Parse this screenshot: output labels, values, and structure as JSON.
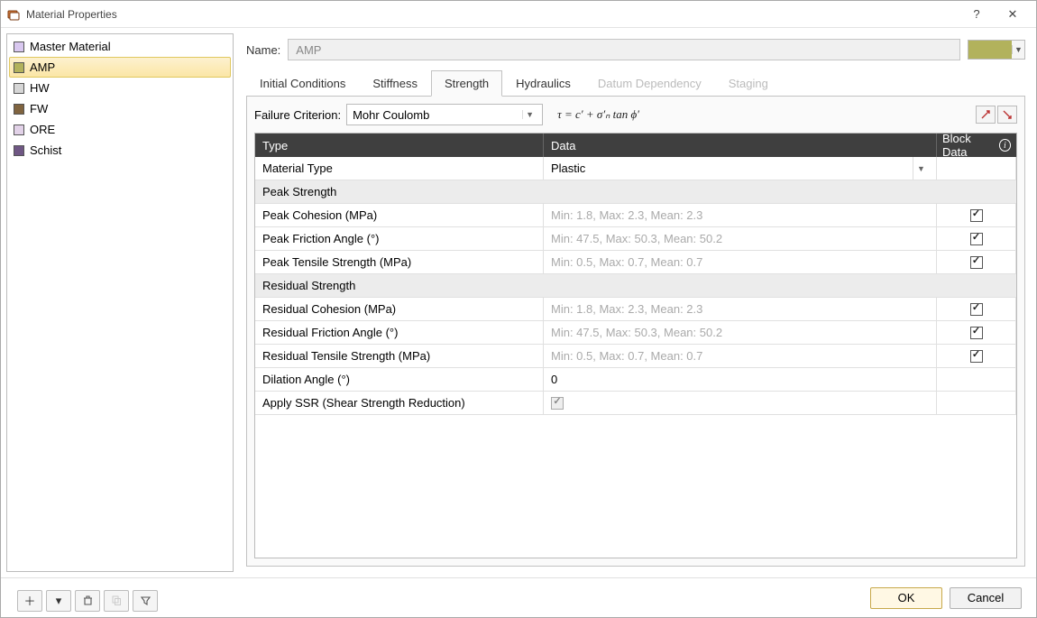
{
  "window": {
    "title": "Material Properties",
    "help": "?",
    "close": "✕"
  },
  "materials": [
    {
      "name": "Master Material",
      "color": "#d9c8f0",
      "selected": false
    },
    {
      "name": "AMP",
      "color": "#b2b25c",
      "selected": true
    },
    {
      "name": "HW",
      "color": "#d6d6d6",
      "selected": false
    },
    {
      "name": "FW",
      "color": "#806440",
      "selected": false
    },
    {
      "name": "ORE",
      "color": "#e2d2e8",
      "selected": false
    },
    {
      "name": "Schist",
      "color": "#6f5784",
      "selected": false
    }
  ],
  "toolbar": {
    "add": "＋",
    "more": "▾",
    "delete": "🗑",
    "copy": "⧉",
    "filter": "⧩"
  },
  "nameRow": {
    "label": "Name:",
    "value": "AMP"
  },
  "colorSwatch": "#b2b25c",
  "tabs": [
    {
      "label": "Initial Conditions",
      "active": false,
      "disabled": false
    },
    {
      "label": "Stiffness",
      "active": false,
      "disabled": false
    },
    {
      "label": "Strength",
      "active": true,
      "disabled": false
    },
    {
      "label": "Hydraulics",
      "active": false,
      "disabled": false
    },
    {
      "label": "Datum Dependency",
      "active": false,
      "disabled": true
    },
    {
      "label": "Staging",
      "active": false,
      "disabled": true
    }
  ],
  "criterion": {
    "label": "Failure Criterion:",
    "value": "Mohr Coulomb",
    "equation": "τ = c′ + σ′ₙ tan ϕ′"
  },
  "gridHeader": {
    "type": "Type",
    "data": "Data",
    "block": "Block Data"
  },
  "rows": [
    {
      "kind": "select",
      "label": "Material Type",
      "value": "Plastic",
      "block": null
    },
    {
      "kind": "section",
      "label": "Peak Strength"
    },
    {
      "kind": "ph",
      "label": "Peak Cohesion (MPa)",
      "value": "Min: 1.8, Max: 2.3, Mean: 2.3",
      "block": true
    },
    {
      "kind": "ph",
      "label": "Peak Friction Angle (°)",
      "value": "Min: 47.5, Max: 50.3, Mean: 50.2",
      "block": true
    },
    {
      "kind": "ph",
      "label": "Peak Tensile Strength (MPa)",
      "value": "Min: 0.5, Max: 0.7, Mean: 0.7",
      "block": true
    },
    {
      "kind": "section",
      "label": "Residual Strength"
    },
    {
      "kind": "ph",
      "label": "Residual Cohesion (MPa)",
      "value": "Min: 1.8, Max: 2.3, Mean: 2.3",
      "block": true
    },
    {
      "kind": "ph",
      "label": "Residual Friction Angle (°)",
      "value": "Min: 47.5, Max: 50.3, Mean: 50.2",
      "block": true
    },
    {
      "kind": "ph",
      "label": "Residual Tensile Strength (MPa)",
      "value": "Min: 0.5, Max: 0.7, Mean: 0.7",
      "block": true
    },
    {
      "kind": "val",
      "label": "Dilation Angle (°)",
      "value": "0",
      "block": null
    },
    {
      "kind": "chk",
      "label": "Apply SSR (Shear Strength Reduction)",
      "value": true,
      "disabled": true,
      "block": null
    }
  ],
  "footer": {
    "ok": "OK",
    "cancel": "Cancel"
  }
}
